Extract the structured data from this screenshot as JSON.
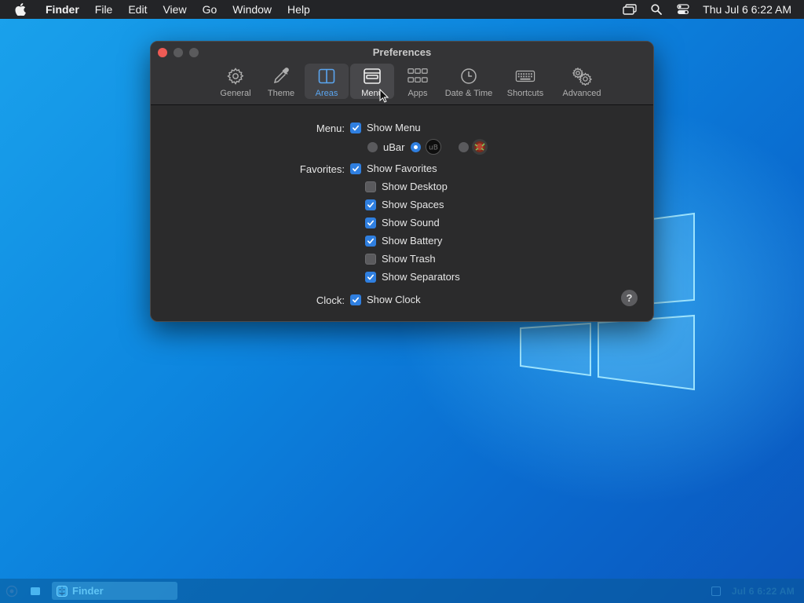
{
  "menubar": {
    "app_name": "Finder",
    "menus": [
      "File",
      "Edit",
      "View",
      "Go",
      "Window",
      "Help"
    ],
    "clock": "Thu Jul 6  6:22 AM"
  },
  "window": {
    "title": "Preferences",
    "tabs": [
      {
        "label": "General",
        "icon": "gear-icon"
      },
      {
        "label": "Theme",
        "icon": "eyedropper-icon"
      },
      {
        "label": "Areas",
        "icon": "split-panel-icon"
      },
      {
        "label": "Menu",
        "icon": "menu-icon"
      },
      {
        "label": "Apps",
        "icon": "apps-grid-icon"
      },
      {
        "label": "Date & Time",
        "icon": "clock-icon"
      },
      {
        "label": "Shortcuts",
        "icon": "keyboard-icon"
      },
      {
        "label": "Advanced",
        "icon": "gears-icon"
      }
    ],
    "selected_tab": "Areas",
    "hovered_tab": "Menu"
  },
  "settings": {
    "menu_label": "Menu:",
    "show_menu": {
      "label": "Show Menu",
      "checked": true
    },
    "menu_style": {
      "options": [
        "uBar",
        "logo-2",
        "logo-3"
      ],
      "ubar_label": "uBar",
      "selected": "logo-2"
    },
    "favorites_label": "Favorites:",
    "show_favorites": {
      "label": "Show Favorites",
      "checked": true
    },
    "favorites_items": [
      {
        "label": "Show Desktop",
        "checked": false
      },
      {
        "label": "Show Spaces",
        "checked": true
      },
      {
        "label": "Show Sound",
        "checked": true
      },
      {
        "label": "Show Battery",
        "checked": true
      },
      {
        "label": "Show Trash",
        "checked": false
      },
      {
        "label": "Show Separators",
        "checked": true
      }
    ],
    "clock_label": "Clock:",
    "show_clock": {
      "label": "Show Clock",
      "checked": true
    }
  },
  "help": {
    "glyph": "?"
  },
  "taskbar": {
    "active_app": "Finder",
    "tray_clock": "Jul 6  6:22 AM"
  },
  "colors": {
    "accent": "#2f7fe0",
    "close": "#ee5b55",
    "window_bg": "#2b2b2c",
    "desktop_blue": "#0d86df"
  }
}
